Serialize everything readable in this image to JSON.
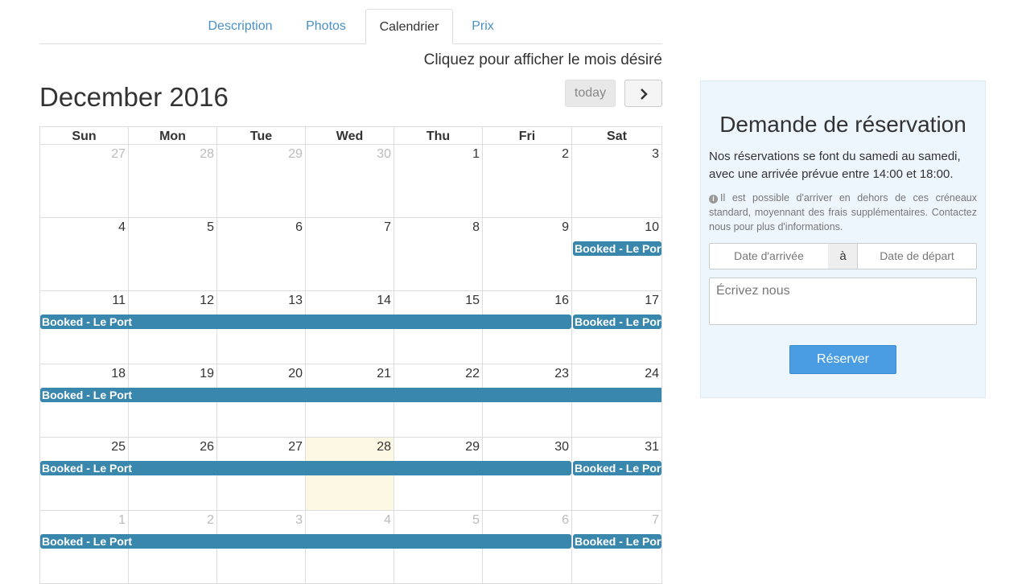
{
  "tabs": [
    {
      "label": "Description",
      "active": false
    },
    {
      "label": "Photos",
      "active": false
    },
    {
      "label": "Calendrier",
      "active": true
    },
    {
      "label": "Prix",
      "active": false
    }
  ],
  "calendar": {
    "hint": "Cliquez pour afficher le mois désiré",
    "title": "December 2016",
    "today_label": "today",
    "next_icon": "chevron-right-icon",
    "day_headers": [
      "Sun",
      "Mon",
      "Tue",
      "Wed",
      "Thu",
      "Fri",
      "Sat"
    ],
    "weeks": [
      [
        {
          "d": "27",
          "other": true
        },
        {
          "d": "28",
          "other": true
        },
        {
          "d": "29",
          "other": true
        },
        {
          "d": "30",
          "other": true
        },
        {
          "d": "1"
        },
        {
          "d": "2"
        },
        {
          "d": "3"
        }
      ],
      [
        {
          "d": "4"
        },
        {
          "d": "5"
        },
        {
          "d": "6"
        },
        {
          "d": "7"
        },
        {
          "d": "8"
        },
        {
          "d": "9"
        },
        {
          "d": "10"
        }
      ],
      [
        {
          "d": "11"
        },
        {
          "d": "12"
        },
        {
          "d": "13"
        },
        {
          "d": "14"
        },
        {
          "d": "15"
        },
        {
          "d": "16"
        },
        {
          "d": "17"
        }
      ],
      [
        {
          "d": "18"
        },
        {
          "d": "19"
        },
        {
          "d": "20"
        },
        {
          "d": "21"
        },
        {
          "d": "22"
        },
        {
          "d": "23"
        },
        {
          "d": "24"
        }
      ],
      [
        {
          "d": "25"
        },
        {
          "d": "26"
        },
        {
          "d": "27"
        },
        {
          "d": "28",
          "today": true
        },
        {
          "d": "29"
        },
        {
          "d": "30"
        },
        {
          "d": "31"
        }
      ],
      [
        {
          "d": "1",
          "other": true
        },
        {
          "d": "2",
          "other": true
        },
        {
          "d": "3",
          "other": true
        },
        {
          "d": "4",
          "other": true
        },
        {
          "d": "5",
          "other": true
        },
        {
          "d": "6",
          "other": true
        },
        {
          "d": "7",
          "other": true
        }
      ]
    ],
    "events": [
      {
        "title": "Booked - Le Port",
        "week": 1,
        "start": 6,
        "end": 6
      },
      {
        "title": "Booked - Le Port",
        "week": 2,
        "start": 0,
        "end": 5
      },
      {
        "title": "Booked - Le Port",
        "week": 2,
        "start": 6,
        "end": 6
      },
      {
        "title": "Booked - Le Port",
        "week": 3,
        "start": 0,
        "end": 6
      },
      {
        "title": "Booked - Le Port",
        "week": 4,
        "start": 0,
        "end": 5
      },
      {
        "title": "Booked - Le Port",
        "week": 4,
        "start": 6,
        "end": 6
      },
      {
        "title": "Booked - Le Port",
        "week": 5,
        "start": 0,
        "end": 5
      },
      {
        "title": "Booked - Le Port",
        "week": 5,
        "start": 6,
        "end": 6
      }
    ],
    "colors": {
      "event": "#3a87ad",
      "today": "#fcf8e3"
    }
  },
  "booking": {
    "title": "Demande de réservation",
    "description": "Nos réservations se font du samedi au samedi, avec une arrivée prévue entre 14:00 et 18:00.",
    "note_icon": "info-icon",
    "note": "Il est possible d'arriver en dehors de ces créneaux standard, moyennant des frais supplémentaires. Contactez nous pour plus d'informations.",
    "arrival_placeholder": "Date d'arrivée",
    "separator": "à",
    "departure_placeholder": "Date de départ",
    "message_placeholder": "Écrivez nous",
    "submit_label": "Réserver",
    "button_color": "#4a9de3",
    "panel_color": "#eef6fd"
  }
}
